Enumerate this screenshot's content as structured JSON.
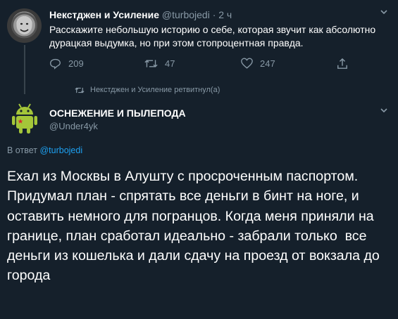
{
  "parent_tweet": {
    "author_name": "Некстджен и Усиление",
    "author_handle": "@turbojedi",
    "time": "· 2 ч",
    "text": "Расскажите небольшую историю о себе, которая звучит как абсолютно дурацкая выдумка, но при этом стопроцентная правда.",
    "reply_count": "209",
    "retweet_count": "47",
    "like_count": "247"
  },
  "retweet_notice": "Некстджен и Усиление ретвитнул(а)",
  "main_tweet": {
    "author_name": "ОСНЕЖЕНИЕ И ПЫЛЕПОДА",
    "author_handle": "@Under4yk",
    "reply_prefix": "В ответ",
    "reply_to": "@turbojedi",
    "text": "Ехал из Москвы в Алушту с просроченным паспортом. Придумал план - спрятать все деньги в бинт на ноге, и оставить немного для погранцов. Когда меня приняли на границе, план сработал идеально - забрали только  все деньги из кошелька и дали сдачу на проезд от вокзала до города"
  },
  "colors": {
    "background": "#15202b",
    "muted": "#8899a6",
    "link": "#1da1f2",
    "android_green": "#a4c639"
  },
  "icons": [
    "reply-icon",
    "retweet-icon",
    "like-icon",
    "share-icon",
    "chevron-down-icon"
  ]
}
